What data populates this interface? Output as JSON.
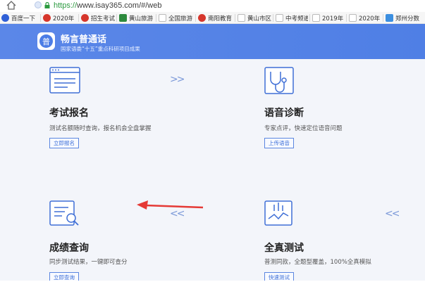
{
  "browser": {
    "url_scheme": "https://",
    "url_rest": "www.isay365.com/#/web",
    "bookmarks": [
      {
        "label": "百度一下",
        "color": "#2f5fd6"
      },
      {
        "label": "2020年",
        "color": "#d6362c"
      },
      {
        "label": "招生考试",
        "color": "#d6362c"
      },
      {
        "label": "黄山旅游",
        "color": "#2d8a3d"
      },
      {
        "label": "全国旅游",
        "color": "#999999"
      },
      {
        "label": "南阳教育",
        "color": "#d6362c"
      },
      {
        "label": "黄山市区",
        "color": "#999999"
      },
      {
        "label": "中考频道",
        "color": "#999999"
      },
      {
        "label": "2019年",
        "color": "#999999"
      },
      {
        "label": "2020年",
        "color": "#999999"
      },
      {
        "label": "郑州分数",
        "color": "#3c8fe0"
      }
    ]
  },
  "header": {
    "logo_char": "普",
    "brand": "畅言普通话",
    "subtitle": "国家语委“十五”重点科研项目成果"
  },
  "cards": {
    "exam_signup": {
      "title": "考试报名",
      "desc": "测试名额随时查询，报名机会全盘掌握",
      "button": "立即报名",
      "arrows": ">>"
    },
    "voice_diagnosis": {
      "title": "语音诊断",
      "desc": "专家点评，快速定位语音问题",
      "button": "上传语音"
    },
    "score_query": {
      "title": "成绩查询",
      "desc": "同步测试结果，一键即可查分",
      "button": "立即查询",
      "arrows": "<<"
    },
    "full_test": {
      "title": "全真测试",
      "desc": "普测同款，全题型覆盖，100%全真模拟",
      "button": "快速测试",
      "arrows": "<<"
    }
  },
  "colors": {
    "header": "#4f7fe5",
    "accent": "#3c6fd9",
    "annotation_arrow": "#e53935"
  }
}
